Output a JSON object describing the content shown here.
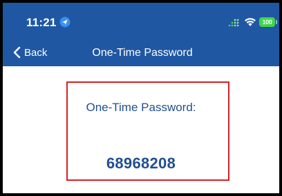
{
  "status_bar": {
    "time": "11:21",
    "battery_level": "100",
    "icons": [
      "location-arrow-icon",
      "signal-icon",
      "wifi-icon",
      "battery-icon"
    ]
  },
  "nav": {
    "back_label": "Back",
    "title": "One-Time Password"
  },
  "otp": {
    "label": "One-Time Password:",
    "value": "68968208"
  },
  "colors": {
    "header_bg": "#1f57a3",
    "text_primary": "#1f4f8f",
    "highlight_border": "#d32026",
    "battery": "#3fd54a"
  }
}
